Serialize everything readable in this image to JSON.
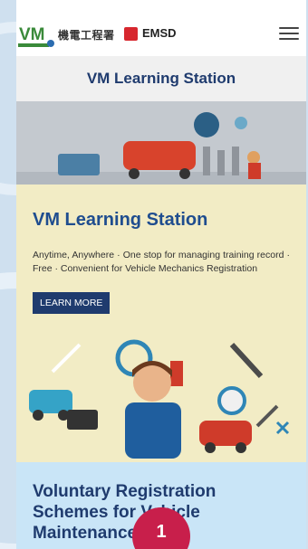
{
  "header": {
    "logo_vm": "VM",
    "logo_cn": "機電工程署",
    "logo_emsd": "EMSD",
    "menu_icon": "hamburger-icon"
  },
  "title_band": {
    "title": "VM Learning Station"
  },
  "card": {
    "heading": "VM Learning Station",
    "description": "Anytime, Anywhere · One stop for managing training record · Free · Convenient for Vehicle Mechanics Registration",
    "button": "LEARN MORE"
  },
  "voluntary": {
    "heading": "Voluntary Registration Schemes for Vehicle Maintenance",
    "step_number": "1"
  },
  "colors": {
    "navy": "#1f3b6e",
    "heading_blue": "#1f4d8f",
    "card_bg": "#f2ecc5",
    "voluntary_bg": "#c9e5f7",
    "step_red": "#c81f4b"
  }
}
